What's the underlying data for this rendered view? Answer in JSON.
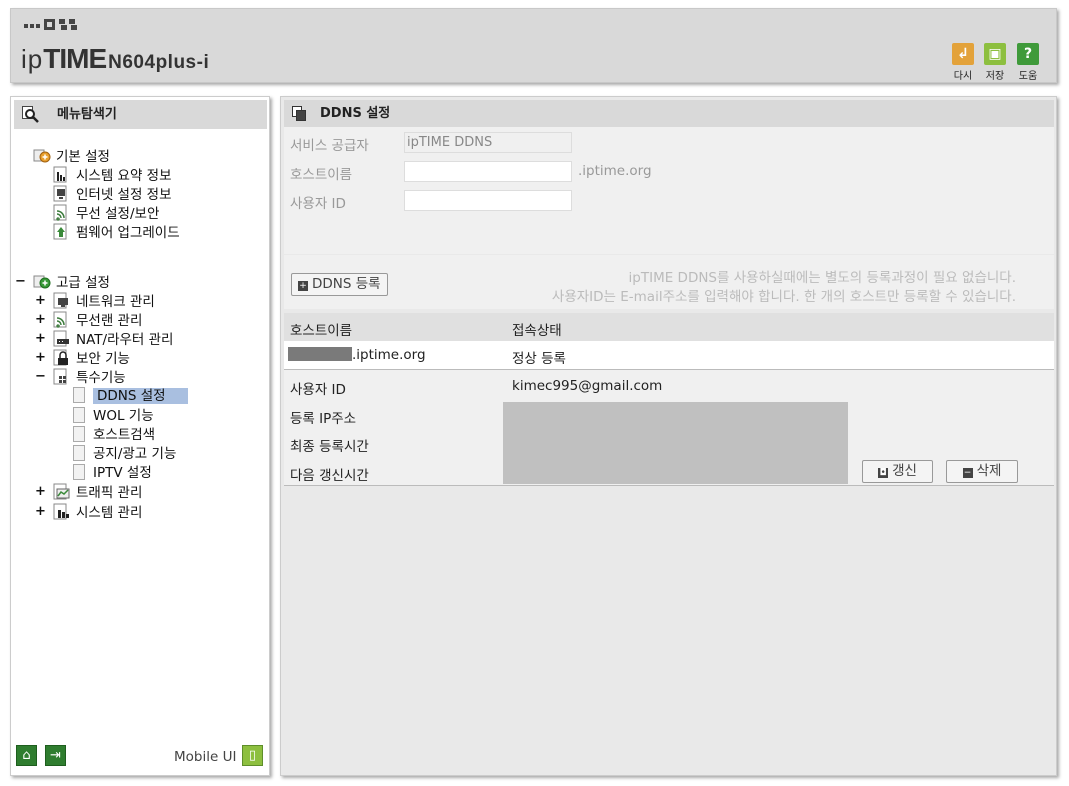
{
  "header": {
    "brand_ip": "ip",
    "brand_time": "TIME",
    "model": "N604plus-i",
    "toolbar": [
      {
        "label": "다시",
        "icon": "undo-icon",
        "color": "#e3a23a"
      },
      {
        "label": "저장",
        "icon": "save-icon",
        "color": "#8dbf3f"
      },
      {
        "label": "도움",
        "icon": "help-icon",
        "color": "#3f9a3a"
      }
    ]
  },
  "sidebar": {
    "title": "메뉴탐색기",
    "basic": {
      "label": "기본 설정",
      "items": [
        "시스템 요약 정보",
        "인터넷 설정 정보",
        "무선 설정/보안",
        "펌웨어 업그레이드"
      ]
    },
    "advanced": {
      "toggle": "−",
      "label": "고급 설정",
      "items": [
        {
          "toggle": "+",
          "label": "네트워크 관리"
        },
        {
          "toggle": "+",
          "label": "무선랜 관리"
        },
        {
          "toggle": "+",
          "label": "NAT/라우터 관리"
        },
        {
          "toggle": "+",
          "label": "보안 기능"
        },
        {
          "toggle": "−",
          "label": "특수기능"
        }
      ],
      "special": [
        "DDNS 설정",
        "WOL 기능",
        "호스트검색",
        "공지/광고 기능",
        "IPTV 설정"
      ],
      "after": [
        {
          "toggle": "+",
          "label": "트래픽 관리"
        },
        {
          "toggle": "+",
          "label": "시스템 관리"
        }
      ]
    },
    "footer": {
      "mobile_label": "Mobile UI"
    }
  },
  "main": {
    "title": "DDNS 설정",
    "form": {
      "provider_label": "서비스 공급자",
      "provider_value": "ipTIME DDNS",
      "host_label": "호스트이름",
      "host_value": "",
      "host_suffix": ".iptime.org",
      "user_label": "사용자 ID",
      "user_value": ""
    },
    "register_button": "DDNS 등록",
    "notes": [
      "ipTIME DDNS를 사용하실때에는 별도의 등록과정이 필요 없습니다.",
      "사용자ID는 E-mail주소를 입력해야 합니다. 한 개의 호스트만 등록할 수 있습니다."
    ],
    "table": {
      "headers": [
        "호스트이름",
        "접속상태"
      ],
      "row": {
        "host_suffix": ".iptime.org",
        "status": "정상 등록"
      }
    },
    "detail": {
      "user_label": "사용자 ID",
      "user_value": "kimec995@gmail.com",
      "ip_label": "등록 IP주소",
      "last_label": "최종 등록시간",
      "next_label": "다음 갱신시간",
      "renew_button": "갱신",
      "delete_button": "삭제"
    }
  }
}
